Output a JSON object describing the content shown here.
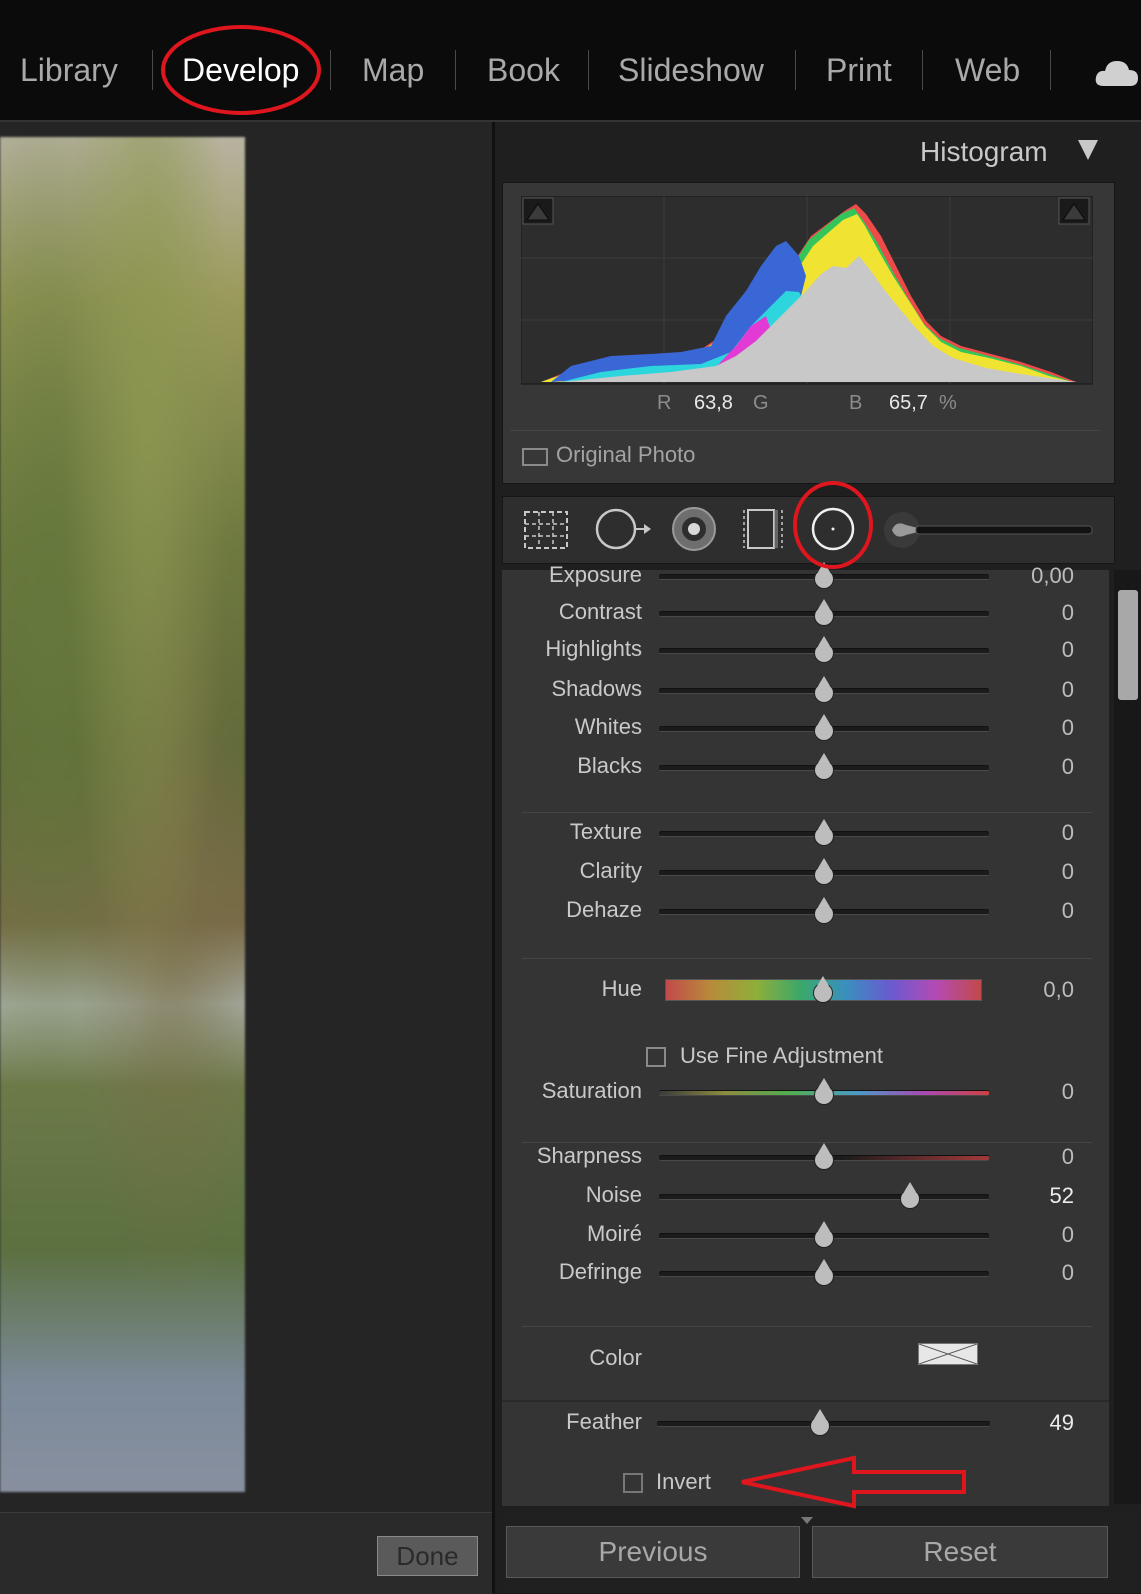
{
  "modules": [
    "Library",
    "Develop",
    "Map",
    "Book",
    "Slideshow",
    "Print",
    "Web"
  ],
  "active_module": "Develop",
  "histogram": {
    "title": "Histogram",
    "r_label": "R",
    "r_value": "63,8",
    "g_label": "G",
    "b_label": "B",
    "b_value": "65,7",
    "percent": "%",
    "original_photo_label": "Original Photo",
    "original_photo_checked": false
  },
  "tools": [
    "crop-overlay-icon",
    "spot-removal-icon",
    "red-eye-icon",
    "graduated-filter-icon",
    "radial-filter-icon",
    "adjustment-brush-icon"
  ],
  "active_tool": "radial-filter-icon",
  "adjustments": {
    "exposure": {
      "label": "Exposure",
      "value": "0,00",
      "position": 0.5
    },
    "contrast": {
      "label": "Contrast",
      "value": "0",
      "position": 0.5
    },
    "highlights": {
      "label": "Highlights",
      "value": "0",
      "position": 0.5
    },
    "shadows": {
      "label": "Shadows",
      "value": "0",
      "position": 0.5
    },
    "whites": {
      "label": "Whites",
      "value": "0",
      "position": 0.5
    },
    "blacks": {
      "label": "Blacks",
      "value": "0",
      "position": 0.5
    },
    "texture": {
      "label": "Texture",
      "value": "0",
      "position": 0.5
    },
    "clarity": {
      "label": "Clarity",
      "value": "0",
      "position": 0.5
    },
    "dehaze": {
      "label": "Dehaze",
      "value": "0",
      "position": 0.5
    },
    "hue": {
      "label": "Hue",
      "value": "0,0",
      "position": 0.5
    },
    "saturation": {
      "label": "Saturation",
      "value": "0",
      "position": 0.5
    },
    "sharpness": {
      "label": "Sharpness",
      "value": "0",
      "position": 0.5
    },
    "noise": {
      "label": "Noise",
      "value": "52",
      "position": 0.76
    },
    "moire": {
      "label": "Moiré",
      "value": "0",
      "position": 0.5
    },
    "defringe": {
      "label": "Defringe",
      "value": "0",
      "position": 0.5
    },
    "feather": {
      "label": "Feather",
      "value": "49",
      "position": 0.49
    }
  },
  "fine_adjustment_label": "Use Fine Adjustment",
  "fine_adjustment_checked": false,
  "color_label": "Color",
  "invert_label": "Invert",
  "invert_checked": false,
  "buttons": {
    "done": "Done",
    "previous": "Previous",
    "reset": "Reset"
  },
  "colors": {
    "annotation": "#e0161e",
    "panel": "#343434",
    "topbar": "#0b0b0b"
  }
}
